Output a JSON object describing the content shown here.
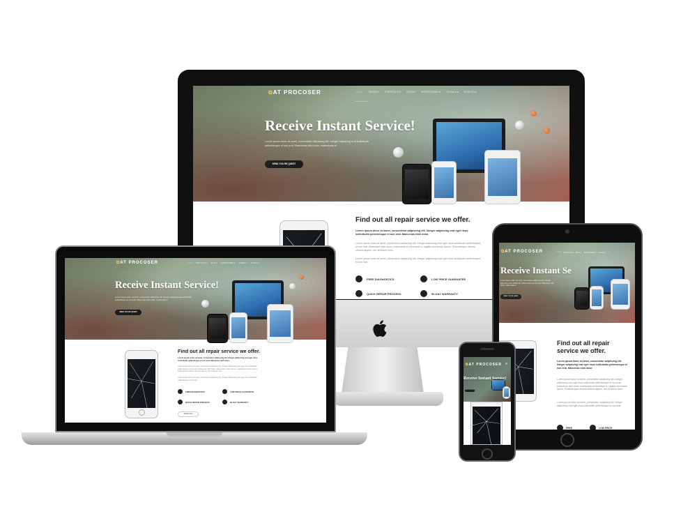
{
  "brand": {
    "logo_text": "AT PROCOSER",
    "logo_mark": "⧉"
  },
  "nav": {
    "items": [
      {
        "label": "HOME"
      },
      {
        "label": "PAGES ▾"
      },
      {
        "label": "PORTFOLIO ▾"
      },
      {
        "label": "BLOG ▾"
      },
      {
        "label": "SHORTCODES ▾"
      },
      {
        "label": "JOOMLA ▾"
      },
      {
        "label": "K2 BLOG ▾"
      }
    ],
    "cart_icon": "cart-icon"
  },
  "hero": {
    "title": "Receive Instant Service!",
    "title_short": "Receive Instant Se",
    "text": "Lorem ipsum dolor sit amet, consectetur adipiscing elit. Integer adipiscing erat sollicitudin pellentesque et non erat. Maecenas nibh dolor, malesuada et",
    "button": "SEND YOU RE QUEST"
  },
  "services": {
    "title": "Find out all repair service we offer.",
    "lead": "Lorem ipsum dolor sit amet, consectetur adipiscing elit. Integer adipiscing erat eget risus sollicitudin pellentesque et non erat. Maecenas nibh dolor.",
    "body1": "Lorem ipsum dolor sit amet, consectetur adipiscing elit. Integer adipiscing erat eget risus sollicitudin pellentesque et non erat. Maecenas nibh dolor, malesuada et bibendum a, sagittis accumsan ipsum. Pellentesque ultrices ultrices sapien, nec tincidunt nunc.",
    "body2": "Lorem ipsum dolor sit amet, consectetur adipiscing elit. Integer adipiscing erat eget risus sollicitudin pellentesque et non erat.",
    "features": [
      {
        "label": "FREE DIAGNOSTICS",
        "icon": "wrench-icon"
      },
      {
        "label": "LOW PRICE GUARANTEE",
        "icon": "tag-icon"
      },
      {
        "label": "QUICK REPAIR PROCESS",
        "icon": "clock-icon"
      },
      {
        "label": "90-DAY WARRANTY",
        "icon": "shield-icon"
      }
    ],
    "features_short": [
      "FREE",
      "LOW PRICE"
    ],
    "read_more": "Read more"
  },
  "colors": {
    "accent": "#8fd0e8",
    "logo_mark": "#e6c04a",
    "button": "#111111"
  }
}
